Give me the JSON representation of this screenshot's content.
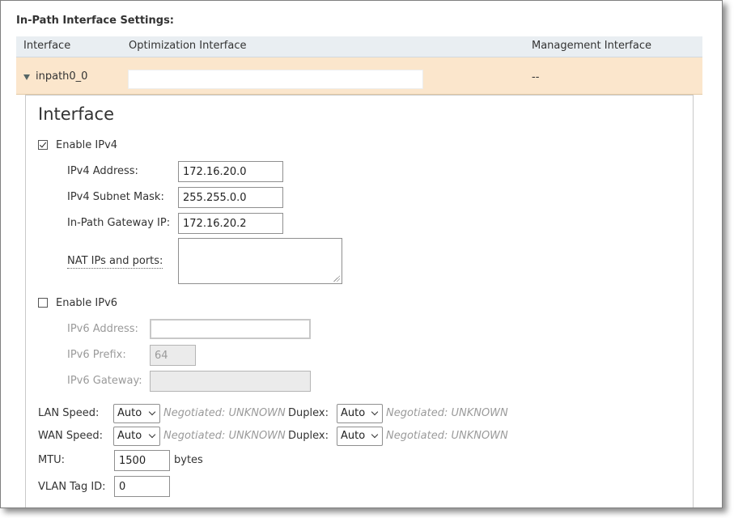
{
  "section_title": "In-Path Interface Settings:",
  "table": {
    "headers": {
      "interface": "Interface",
      "optimization": "Optimization Interface",
      "management": "Management Interface"
    },
    "row": {
      "name": "inpath0_0",
      "management_value": "--"
    }
  },
  "panel": {
    "title": "Interface",
    "ipv4": {
      "enable_label": "Enable IPv4",
      "enabled": true,
      "address_label": "IPv4 Address:",
      "address_value": "172.16.20.0",
      "mask_label": "IPv4 Subnet Mask:",
      "mask_value": "255.255.0.0",
      "gateway_label": "In-Path Gateway IP:",
      "gateway_value": "172.16.20.2",
      "nat_label": "NAT IPs and ports:",
      "nat_value": ""
    },
    "ipv6": {
      "enable_label": "Enable IPv6",
      "enabled": false,
      "address_label": "IPv6 Address:",
      "address_value": "",
      "prefix_label": "IPv6 Prefix:",
      "prefix_value": "64",
      "gateway_label": "IPv6 Gateway:",
      "gateway_value": ""
    },
    "lan": {
      "speed_label": "LAN Speed:",
      "speed_value": "Auto",
      "speed_negotiated": "Negotiated: UNKNOWN",
      "duplex_label": "Duplex:",
      "duplex_value": "Auto",
      "duplex_negotiated": "Negotiated: UNKNOWN"
    },
    "wan": {
      "speed_label": "WAN Speed:",
      "speed_value": "Auto",
      "speed_negotiated": "Negotiated: UNKNOWN",
      "duplex_label": "Duplex:",
      "duplex_value": "Auto",
      "duplex_negotiated": "Negotiated: UNKNOWN"
    },
    "mtu": {
      "label": "MTU:",
      "value": "1500",
      "unit": "bytes"
    },
    "vlan": {
      "label": "VLAN Tag ID:",
      "value": "0"
    }
  },
  "colors": {
    "row_highlight": "#fbe6cc",
    "header_bg": "#e9eef2",
    "disabled_text": "#9a9a9a"
  }
}
